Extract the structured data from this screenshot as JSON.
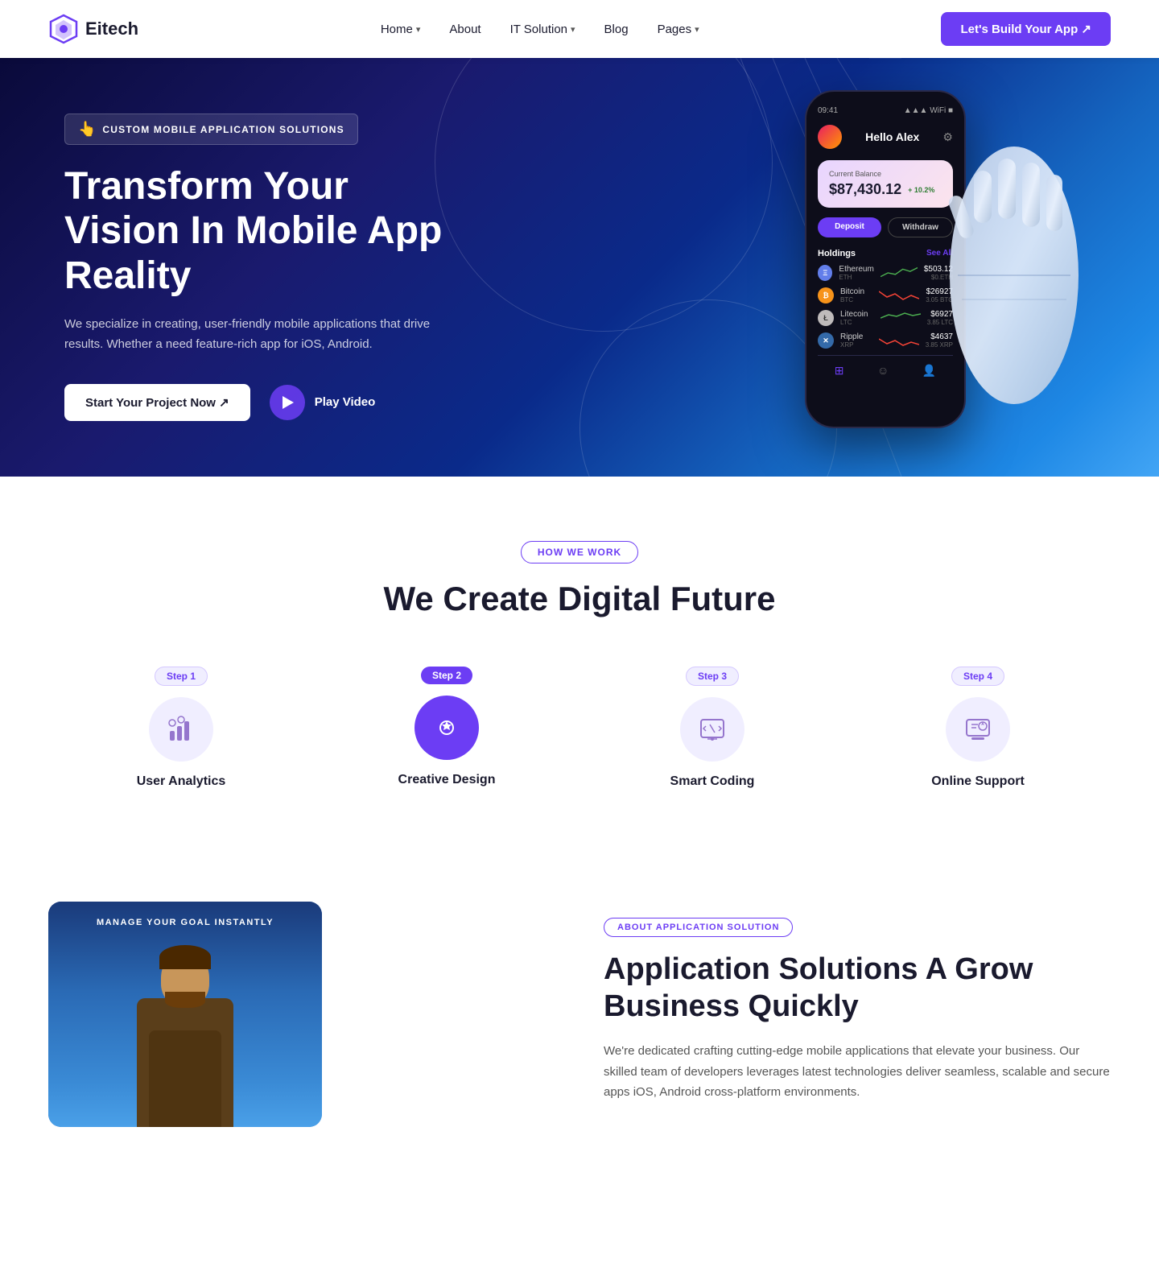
{
  "brand": {
    "name": "Eitech",
    "logo_alt": "Eitech logo"
  },
  "nav": {
    "links": [
      {
        "label": "Home",
        "has_dropdown": true
      },
      {
        "label": "About",
        "has_dropdown": false
      },
      {
        "label": "IT Solution",
        "has_dropdown": true
      },
      {
        "label": "Blog",
        "has_dropdown": false
      },
      {
        "label": "Pages",
        "has_dropdown": true
      }
    ],
    "cta_label": "Let's Build Your App ↗"
  },
  "hero": {
    "badge_icon": "👆",
    "badge_text": "CUSTOM MOBILE APPLICATION SOLUTIONS",
    "title": "Transform Your Vision In Mobile App Reality",
    "description": "We specialize in creating, user-friendly mobile applications that drive results. Whether a need feature-rich app for iOS, Android.",
    "btn_start": "Start Your Project Now ↗",
    "btn_play": "Play Video",
    "phone": {
      "time": "09:41",
      "greeting": "Hello Alex",
      "balance_label": "Current Balance",
      "balance_amount": "$87,430.12",
      "balance_change": "+ 10.2%",
      "btn_deposit": "Deposit",
      "btn_withdraw": "Withdraw",
      "holdings_label": "Holdings",
      "see_all": "See All",
      "coins": [
        {
          "name": "Ethereum",
          "ticker": "ETH",
          "price": "$503.12",
          "sub": "$0.ETH",
          "color": "#627eea",
          "letter": "Ξ"
        },
        {
          "name": "Bitcoin",
          "ticker": "BTC",
          "price": "$26927",
          "sub": "3.05 BTC",
          "color": "#f7931a",
          "letter": "₿"
        },
        {
          "name": "Litecoin",
          "ticker": "LTC",
          "price": "$6927",
          "sub": "3.85 LTC",
          "color": "#bfbbbb",
          "letter": "Ł"
        },
        {
          "name": "Ripple",
          "ticker": "XRP",
          "price": "$4637",
          "sub": "3.85 XRP",
          "color": "#346aa9",
          "letter": "✕"
        }
      ]
    }
  },
  "how": {
    "badge": "HOW WE WORK",
    "title": "We Create Digital Future",
    "steps": [
      {
        "label": "Step 1",
        "name": "User Analytics",
        "icon": "📊",
        "active": false
      },
      {
        "label": "Step 2",
        "name": "Creative Design",
        "icon": "⚙️",
        "active": true
      },
      {
        "label": "Step 3",
        "name": "Smart Coding",
        "icon": "💻",
        "active": false
      },
      {
        "label": "Step 4",
        "name": "Online Support",
        "icon": "🖥️",
        "active": false
      }
    ]
  },
  "about": {
    "badge": "ABOUT APPLICATION SOLUTION",
    "title": "Application Solutions A Grow Business Quickly",
    "description": "We're dedicated crafting cutting-edge mobile applications that elevate your business. Our skilled team of developers leverages latest technologies deliver seamless, scalable and secure apps iOS, Android cross-platform environments.",
    "img_label": "MANAGE YOUR GOAL INSTANTLY"
  }
}
